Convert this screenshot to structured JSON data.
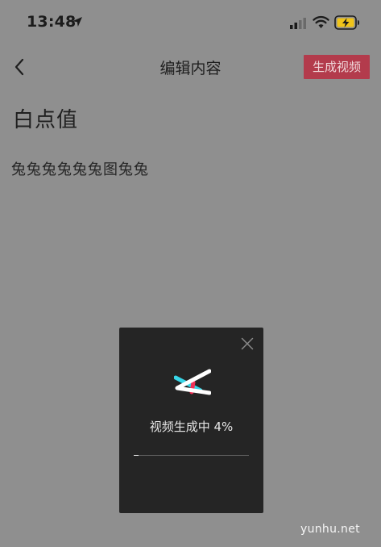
{
  "status_bar": {
    "time": "13:48",
    "icons": [
      "location-icon",
      "signal-icon",
      "wifi-icon",
      "battery-charging-icon"
    ]
  },
  "nav": {
    "back_icon": "chevron-left-icon",
    "title": "编辑内容",
    "generate_label": "生成视频",
    "generate_color": "#b33b4c"
  },
  "content": {
    "title": "白点值",
    "text": "兔兔兔兔兔兔图兔兔"
  },
  "modal": {
    "close_icon": "close-icon",
    "logo_icon": "capcut-logo-icon",
    "status_label": "视频生成中",
    "progress_text": "4%",
    "progress": 0.04
  },
  "watermark": {
    "text": "yunhu.net"
  }
}
